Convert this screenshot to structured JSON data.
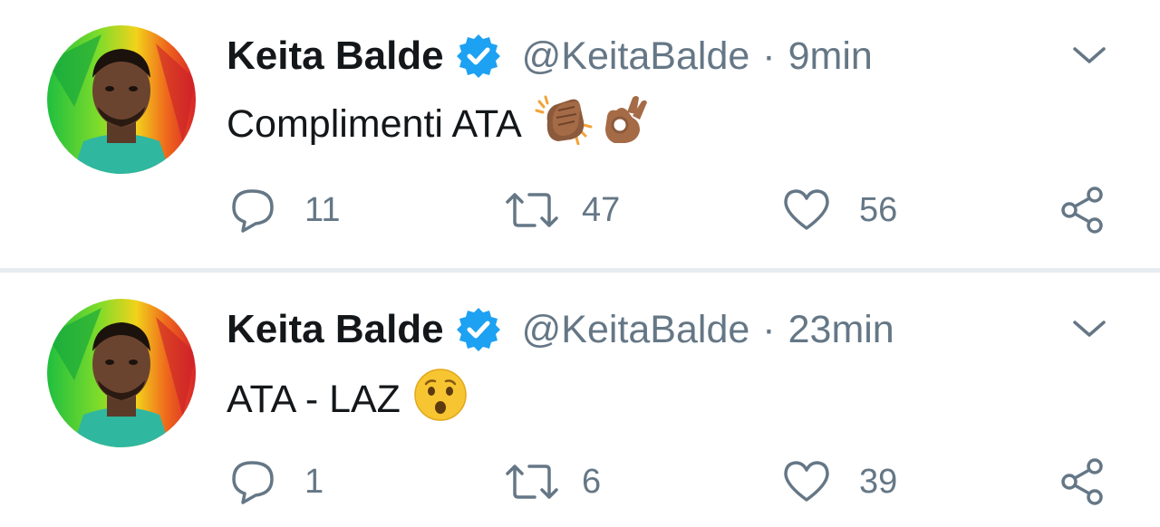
{
  "tweets": [
    {
      "display_name": "Keita Balde",
      "handle": "@KeitaBalde",
      "separator": "·",
      "time": "9min",
      "text": "Complimenti ATA",
      "emojis": [
        "clapping-hands-emoji",
        "ok-hand-emoji"
      ],
      "reply_count": "11",
      "retweet_count": "47",
      "like_count": "56"
    },
    {
      "display_name": "Keita Balde",
      "handle": "@KeitaBalde",
      "separator": "·",
      "time": "23min",
      "text": "ATA - LAZ",
      "emojis": [
        "hushed-face-emoji"
      ],
      "reply_count": "1",
      "retweet_count": "6",
      "like_count": "39"
    }
  ],
  "colors": {
    "name": "#14171a",
    "secondary": "#657786",
    "verified": "#1da1f2",
    "divider": "#e6ecf0"
  }
}
